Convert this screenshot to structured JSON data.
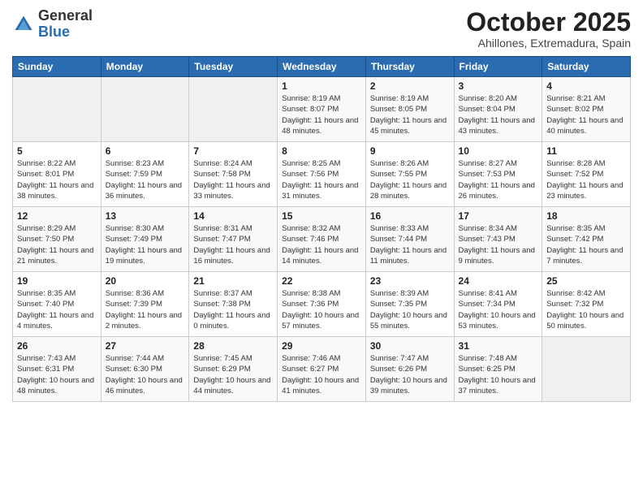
{
  "logo": {
    "general": "General",
    "blue": "Blue"
  },
  "title": "October 2025",
  "subtitle": "Ahillones, Extremadura, Spain",
  "days_of_week": [
    "Sunday",
    "Monday",
    "Tuesday",
    "Wednesday",
    "Thursday",
    "Friday",
    "Saturday"
  ],
  "weeks": [
    [
      {
        "day": "",
        "info": ""
      },
      {
        "day": "",
        "info": ""
      },
      {
        "day": "",
        "info": ""
      },
      {
        "day": "1",
        "info": "Sunrise: 8:19 AM\nSunset: 8:07 PM\nDaylight: 11 hours and 48 minutes."
      },
      {
        "day": "2",
        "info": "Sunrise: 8:19 AM\nSunset: 8:05 PM\nDaylight: 11 hours and 45 minutes."
      },
      {
        "day": "3",
        "info": "Sunrise: 8:20 AM\nSunset: 8:04 PM\nDaylight: 11 hours and 43 minutes."
      },
      {
        "day": "4",
        "info": "Sunrise: 8:21 AM\nSunset: 8:02 PM\nDaylight: 11 hours and 40 minutes."
      }
    ],
    [
      {
        "day": "5",
        "info": "Sunrise: 8:22 AM\nSunset: 8:01 PM\nDaylight: 11 hours and 38 minutes."
      },
      {
        "day": "6",
        "info": "Sunrise: 8:23 AM\nSunset: 7:59 PM\nDaylight: 11 hours and 36 minutes."
      },
      {
        "day": "7",
        "info": "Sunrise: 8:24 AM\nSunset: 7:58 PM\nDaylight: 11 hours and 33 minutes."
      },
      {
        "day": "8",
        "info": "Sunrise: 8:25 AM\nSunset: 7:56 PM\nDaylight: 11 hours and 31 minutes."
      },
      {
        "day": "9",
        "info": "Sunrise: 8:26 AM\nSunset: 7:55 PM\nDaylight: 11 hours and 28 minutes."
      },
      {
        "day": "10",
        "info": "Sunrise: 8:27 AM\nSunset: 7:53 PM\nDaylight: 11 hours and 26 minutes."
      },
      {
        "day": "11",
        "info": "Sunrise: 8:28 AM\nSunset: 7:52 PM\nDaylight: 11 hours and 23 minutes."
      }
    ],
    [
      {
        "day": "12",
        "info": "Sunrise: 8:29 AM\nSunset: 7:50 PM\nDaylight: 11 hours and 21 minutes."
      },
      {
        "day": "13",
        "info": "Sunrise: 8:30 AM\nSunset: 7:49 PM\nDaylight: 11 hours and 19 minutes."
      },
      {
        "day": "14",
        "info": "Sunrise: 8:31 AM\nSunset: 7:47 PM\nDaylight: 11 hours and 16 minutes."
      },
      {
        "day": "15",
        "info": "Sunrise: 8:32 AM\nSunset: 7:46 PM\nDaylight: 11 hours and 14 minutes."
      },
      {
        "day": "16",
        "info": "Sunrise: 8:33 AM\nSunset: 7:44 PM\nDaylight: 11 hours and 11 minutes."
      },
      {
        "day": "17",
        "info": "Sunrise: 8:34 AM\nSunset: 7:43 PM\nDaylight: 11 hours and 9 minutes."
      },
      {
        "day": "18",
        "info": "Sunrise: 8:35 AM\nSunset: 7:42 PM\nDaylight: 11 hours and 7 minutes."
      }
    ],
    [
      {
        "day": "19",
        "info": "Sunrise: 8:35 AM\nSunset: 7:40 PM\nDaylight: 11 hours and 4 minutes."
      },
      {
        "day": "20",
        "info": "Sunrise: 8:36 AM\nSunset: 7:39 PM\nDaylight: 11 hours and 2 minutes."
      },
      {
        "day": "21",
        "info": "Sunrise: 8:37 AM\nSunset: 7:38 PM\nDaylight: 11 hours and 0 minutes."
      },
      {
        "day": "22",
        "info": "Sunrise: 8:38 AM\nSunset: 7:36 PM\nDaylight: 10 hours and 57 minutes."
      },
      {
        "day": "23",
        "info": "Sunrise: 8:39 AM\nSunset: 7:35 PM\nDaylight: 10 hours and 55 minutes."
      },
      {
        "day": "24",
        "info": "Sunrise: 8:41 AM\nSunset: 7:34 PM\nDaylight: 10 hours and 53 minutes."
      },
      {
        "day": "25",
        "info": "Sunrise: 8:42 AM\nSunset: 7:32 PM\nDaylight: 10 hours and 50 minutes."
      }
    ],
    [
      {
        "day": "26",
        "info": "Sunrise: 7:43 AM\nSunset: 6:31 PM\nDaylight: 10 hours and 48 minutes."
      },
      {
        "day": "27",
        "info": "Sunrise: 7:44 AM\nSunset: 6:30 PM\nDaylight: 10 hours and 46 minutes."
      },
      {
        "day": "28",
        "info": "Sunrise: 7:45 AM\nSunset: 6:29 PM\nDaylight: 10 hours and 44 minutes."
      },
      {
        "day": "29",
        "info": "Sunrise: 7:46 AM\nSunset: 6:27 PM\nDaylight: 10 hours and 41 minutes."
      },
      {
        "day": "30",
        "info": "Sunrise: 7:47 AM\nSunset: 6:26 PM\nDaylight: 10 hours and 39 minutes."
      },
      {
        "day": "31",
        "info": "Sunrise: 7:48 AM\nSunset: 6:25 PM\nDaylight: 10 hours and 37 minutes."
      },
      {
        "day": "",
        "info": ""
      }
    ]
  ]
}
